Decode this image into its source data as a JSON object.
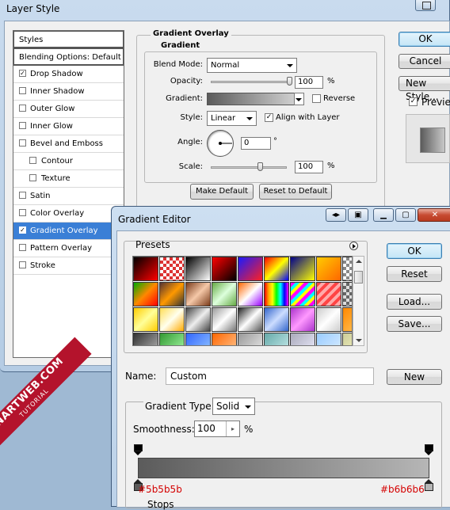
{
  "layer_style": {
    "title": "Layer Style",
    "styles": [
      {
        "label": "Styles",
        "header": true
      },
      {
        "label": "Blending Options: Default",
        "header": true
      },
      {
        "label": "Drop Shadow",
        "checked": true
      },
      {
        "label": "Inner Shadow",
        "checked": false
      },
      {
        "label": "Outer Glow",
        "checked": false
      },
      {
        "label": "Inner Glow",
        "checked": false
      },
      {
        "label": "Bevel and Emboss",
        "checked": false
      },
      {
        "label": "Contour",
        "checked": false,
        "indent": true
      },
      {
        "label": "Texture",
        "checked": false,
        "indent": true
      },
      {
        "label": "Satin",
        "checked": false
      },
      {
        "label": "Color Overlay",
        "checked": false
      },
      {
        "label": "Gradient Overlay",
        "checked": true,
        "selected": true
      },
      {
        "label": "Pattern Overlay",
        "checked": false
      },
      {
        "label": "Stroke",
        "checked": false
      }
    ],
    "panel": {
      "title": "Gradient Overlay",
      "subtitle": "Gradient",
      "blend_mode_label": "Blend Mode:",
      "blend_mode_value": "Normal",
      "opacity_label": "Opacity:",
      "opacity_value": "100",
      "opacity_unit": "%",
      "opacity_fraction": 1.0,
      "gradient_label": "Gradient:",
      "reverse_label": "Reverse",
      "reverse_checked": false,
      "style_label": "Style:",
      "style_value": "Linear",
      "align_label": "Align with Layer",
      "align_checked": true,
      "angle_label": "Angle:",
      "angle_value": "0",
      "angle_unit": "°",
      "scale_label": "Scale:",
      "scale_value": "100",
      "scale_unit": "%",
      "scale_fraction": 0.66,
      "make_default_label": "Make Default",
      "reset_default_label": "Reset to Default"
    },
    "buttons": {
      "ok": "OK",
      "cancel": "Cancel",
      "new_style": "New Style...",
      "preview_label": "Preview",
      "preview_checked": true
    }
  },
  "gradient_editor": {
    "title": "Gradient Editor",
    "presets_label": "Presets",
    "buttons": {
      "ok": "OK",
      "reset": "Reset",
      "load": "Load...",
      "save": "Save...",
      "new": "New"
    },
    "name_label": "Name:",
    "name_value": "Custom",
    "gradient_type_label": "Gradient Type:",
    "gradient_type_value": "Solid",
    "smoothness_label": "Smoothness:",
    "smoothness_value": "100",
    "smoothness_unit": "%",
    "stops_label": "Stops",
    "left_stop_hex": "#5b5b5b",
    "right_stop_hex": "#b6b6b6",
    "colors": {
      "left_stop": "#5b5b5b",
      "right_stop": "#b6b6b6"
    }
  },
  "watermark": {
    "main": "VNARTWEB.COM",
    "sub": "TUTORIAL"
  }
}
